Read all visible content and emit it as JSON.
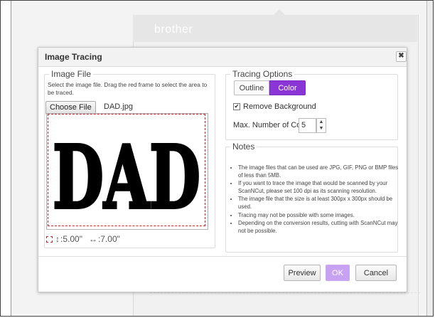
{
  "dialog": {
    "title": "Image Tracing",
    "close_icon": "close-icon",
    "close_label": "✖"
  },
  "background": {
    "brand": "brother"
  },
  "image_file": {
    "legend": "Image File",
    "description": "Select the image file. Drag the red frame to select the area to be traced.",
    "choose_button": "Choose File",
    "file_name": "DAD.jpg",
    "preview_text": "DAD",
    "height_value": ":5.00\"",
    "width_value": ":7.00\"",
    "height_icon": "vertical-resize-icon",
    "width_icon": "horizontal-resize-icon",
    "height_glyph": "↕",
    "width_glyph": "↔"
  },
  "tracing_options": {
    "legend": "Tracing Options",
    "modes": [
      {
        "label": "Outline",
        "selected": false
      },
      {
        "label": "Color",
        "selected": true
      }
    ],
    "remove_background": {
      "label": "Remove Background",
      "checked": true,
      "check_glyph": "✔"
    },
    "max_colors": {
      "label": "Max. Number of Colors",
      "value": "5",
      "spin_up": "▲",
      "spin_down": "▼"
    }
  },
  "notes": {
    "legend": "Notes",
    "items": [
      "The image files that can be used are JPG, GIF, PNG or BMP files of less than 5MB.",
      "If you want to trace the image that would be scanned by your ScanNCut, please set 100 dpi as its scanning resolution.",
      "The image file that the size is at least 300px x 300px should be used.",
      "Tracing may not be possible with some images.",
      "Depending on the conversion results, cutting with ScanNCut may not be possible."
    ]
  },
  "footer": {
    "preview_button": "Preview",
    "ok_button": "OK",
    "cancel_button": "Cancel"
  },
  "colors": {
    "accent": "#8a35d6",
    "ok_disabled": "#c8a2f2",
    "selection_frame": "#d4242a"
  }
}
